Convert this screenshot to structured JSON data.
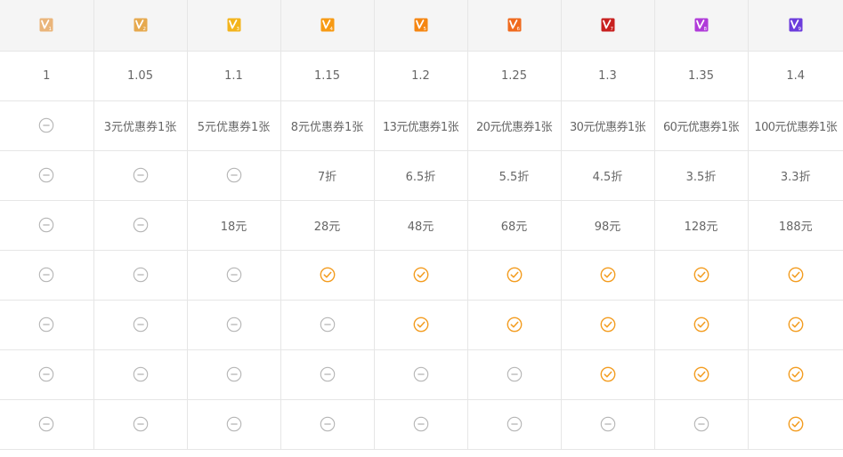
{
  "levels": [
    {
      "num": "1",
      "color": "#eab57a"
    },
    {
      "num": "2",
      "color": "#e6a94e"
    },
    {
      "num": "3",
      "color": "#f3b41c"
    },
    {
      "num": "4",
      "color": "#f79a14"
    },
    {
      "num": "5",
      "color": "#f58612"
    },
    {
      "num": "6",
      "color": "#f06a1e"
    },
    {
      "num": "7",
      "color": "#c8201f"
    },
    {
      "num": "8",
      "color": "#b03bd9"
    },
    {
      "num": "9",
      "color": "#6c3cdc"
    }
  ],
  "colors": {
    "check": "#f39c1f",
    "none": "#b5b5b5",
    "header_bg": "#f5f5f5",
    "grid": "#e6e6e6",
    "text": "#666666"
  },
  "rows": [
    [
      "1",
      "1.05",
      "1.1",
      "1.15",
      "1.2",
      "1.25",
      "1.3",
      "1.35",
      "1.4"
    ],
    [
      "none",
      "3元优惠券1张",
      "5元优惠券1张",
      "8元优惠券1张",
      "13元优惠券1张",
      "20元优惠券1张",
      "30元优惠券1张",
      "60元优惠券1张",
      "100元优惠券1张"
    ],
    [
      "none",
      "none",
      "none",
      "7折",
      "6.5折",
      "5.5折",
      "4.5折",
      "3.5折",
      "3.3折"
    ],
    [
      "none",
      "none",
      "18元",
      "28元",
      "48元",
      "68元",
      "98元",
      "128元",
      "188元"
    ],
    [
      "none",
      "none",
      "none",
      "check",
      "check",
      "check",
      "check",
      "check",
      "check"
    ],
    [
      "none",
      "none",
      "none",
      "none",
      "check",
      "check",
      "check",
      "check",
      "check"
    ],
    [
      "none",
      "none",
      "none",
      "none",
      "none",
      "none",
      "check",
      "check",
      "check"
    ],
    [
      "none",
      "none",
      "none",
      "none",
      "none",
      "none",
      "none",
      "none",
      "check"
    ]
  ]
}
